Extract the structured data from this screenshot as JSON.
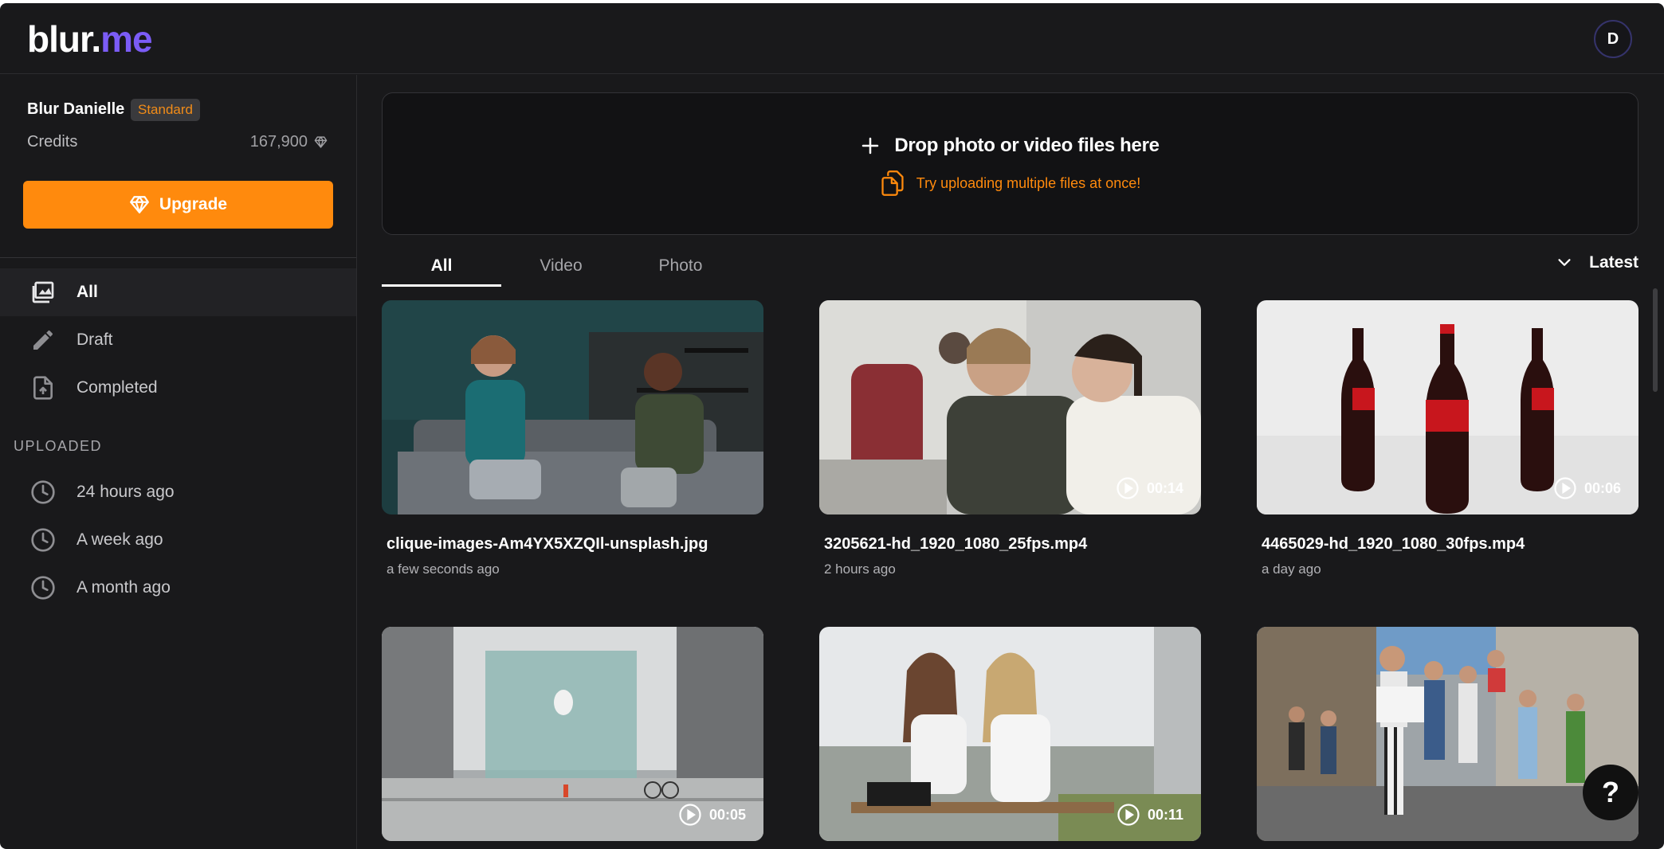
{
  "header": {
    "logo_blur": "blur",
    "logo_dot": ".",
    "logo_me": "me",
    "avatar_initial": "D"
  },
  "sidebar": {
    "user_name": "Blur Danielle",
    "plan": "Standard",
    "credits_label": "Credits",
    "credits_value": "167,900",
    "upgrade_label": "Upgrade",
    "nav": [
      {
        "label": "All",
        "icon": "gallery-icon",
        "active": true
      },
      {
        "label": "Draft",
        "icon": "pencil-icon",
        "active": false
      },
      {
        "label": "Completed",
        "icon": "file-upload-icon",
        "active": false
      }
    ],
    "uploaded_title": "UPLOADED",
    "uploaded": [
      {
        "label": "24 hours ago",
        "icon": "clock-icon"
      },
      {
        "label": "A week ago",
        "icon": "clock-icon"
      },
      {
        "label": "A month ago",
        "icon": "clock-icon"
      }
    ]
  },
  "dropzone": {
    "title": "Drop photo or video files here",
    "hint": "Try uploading multiple files at once!"
  },
  "tabs": [
    "All",
    "Video",
    "Photo"
  ],
  "active_tab": "All",
  "sort_label": "Latest",
  "files": [
    {
      "name": "clique-images-Am4YX5XZQIl-unsplash.jpg",
      "time": "a few seconds ago",
      "duration": ""
    },
    {
      "name": "3205621-hd_1920_1080_25fps.mp4",
      "time": "2 hours ago",
      "duration": "00:14"
    },
    {
      "name": "4465029-hd_1920_1080_30fps.mp4",
      "time": "a day ago",
      "duration": "00:06"
    },
    {
      "name": "",
      "time": "",
      "duration": "00:05"
    },
    {
      "name": "",
      "time": "",
      "duration": "00:11"
    },
    {
      "name": "",
      "time": "",
      "duration": ""
    }
  ],
  "help_label": "?",
  "colors": {
    "accent": "#ff8a0d",
    "brand": "#7b5cf6",
    "background": "#19191b"
  }
}
